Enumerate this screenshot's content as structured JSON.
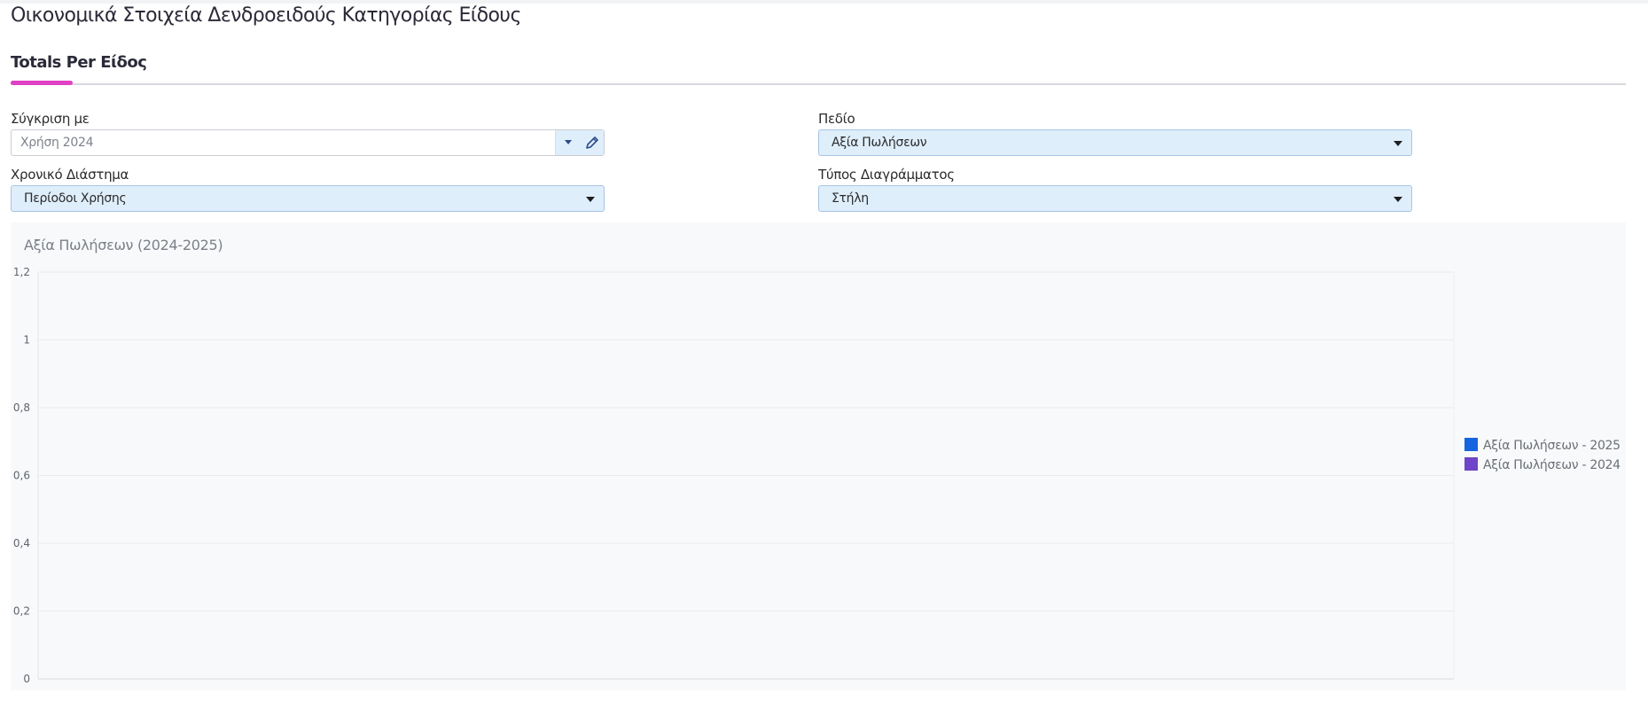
{
  "page": {
    "title": "Οικονομικά Στοιχεία Δενδροειδούς Κατηγορίας Είδους"
  },
  "tabs": [
    {
      "label": "Totals Per Είδος",
      "active": true
    }
  ],
  "filters": {
    "compare": {
      "label": "Σύγκριση με",
      "value": "Χρήση 2024",
      "icons": [
        "chevron-down-icon",
        "pencil-icon"
      ]
    },
    "field": {
      "label": "Πεδίο",
      "value": "Αξία Πωλήσεων"
    },
    "period": {
      "label": "Χρονικό Διάστημα",
      "value": "Περίοδοι Χρήσης"
    },
    "chart_type": {
      "label": "Τύπος Διαγράμματος",
      "value": "Στήλη"
    }
  },
  "colors": {
    "accent": "#e040c4",
    "select_bg": "#dfeefb",
    "series_2025": "#1565e0",
    "series_2024": "#6f44c8"
  },
  "chart_data": {
    "type": "bar",
    "title": "Αξία Πωλήσεων (2024-2025)",
    "xlabel": "",
    "ylabel": "",
    "ylim": [
      0,
      1.2
    ],
    "yticks": [
      "0",
      "0,2",
      "0,4",
      "0,6",
      "0,8",
      "1",
      "1,2"
    ],
    "grid": true,
    "legend_position": "right",
    "categories": [],
    "series": [
      {
        "name": "Αξία Πωλήσεων - 2025",
        "color": "#1565e0",
        "values": []
      },
      {
        "name": "Αξία Πωλήσεων - 2024",
        "color": "#6f44c8",
        "values": []
      }
    ]
  }
}
